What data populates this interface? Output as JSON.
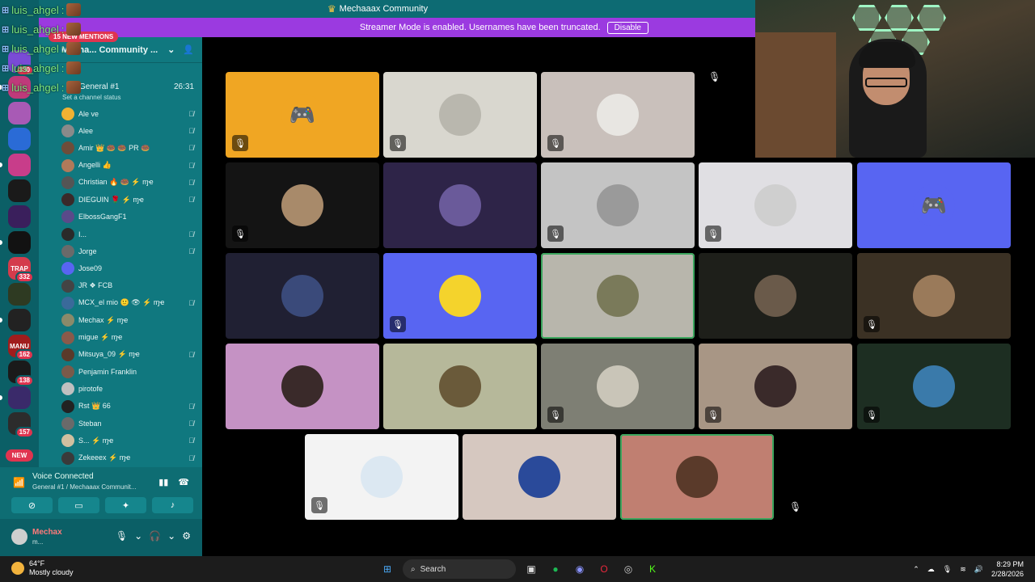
{
  "title_bar": {
    "server_title": "Mechaaax Community",
    "crown_icon": "crown-icon"
  },
  "streamer_banner": {
    "text": "Streamer Mode is enabled. Usernames have been truncated.",
    "button": "Disable"
  },
  "chat_overlay": [
    {
      "user": "luis_ahgel",
      "sep": ":"
    },
    {
      "user": "luis_ahgel",
      "sep": ":"
    },
    {
      "user": "luis_ahgel",
      "sep": ":"
    },
    {
      "user": "luis_ahgel",
      "sep": ":"
    },
    {
      "user": "luis_ahgel",
      "sep": ":"
    }
  ],
  "servers": [
    {
      "label": "",
      "badge": "330",
      "color": "#7a4bd6"
    },
    {
      "label": "",
      "badge": "",
      "color": "#bf3a7a"
    },
    {
      "label": "",
      "badge": "",
      "color": "#a85ab5"
    },
    {
      "label": "",
      "badge": "",
      "color": "#2a6bd6"
    },
    {
      "label": "",
      "badge": "",
      "color": "#c83d8a"
    },
    {
      "label": "",
      "badge": "",
      "color": "#1a1a1a"
    },
    {
      "label": "",
      "badge": "",
      "color": "#3a1f5c"
    },
    {
      "label": "",
      "badge": "",
      "color": "#121212"
    },
    {
      "label": "TRAP",
      "badge": "332",
      "color": "#d43c4c"
    },
    {
      "label": "",
      "badge": "",
      "color": "#2e3a22"
    },
    {
      "label": "",
      "badge": "",
      "color": "#222222"
    },
    {
      "label": "MANU",
      "badge": "162",
      "color": "#a01d1d"
    },
    {
      "label": "",
      "badge": "138",
      "color": "#1a1a1a"
    },
    {
      "label": "",
      "badge": "",
      "color": "#3a2a6a"
    },
    {
      "label": "",
      "badge": "157",
      "color": "#2c2c2c"
    }
  ],
  "new_pill": "NEW",
  "sidebar": {
    "server_name": "Mecha... Community ...",
    "mentions": "15 NEW MENTIONS",
    "channel_name": "General #1",
    "channel_time": "26:31",
    "channel_status": "Set a channel status",
    "members": [
      {
        "name": "Ale ve",
        "color": "#f0b232",
        "muted": true
      },
      {
        "name": "Alee",
        "color": "#8a8a8a",
        "muted": true
      },
      {
        "name": "Amir 👑 🍩 🍩 PR 🍩",
        "color": "#6e4d3a",
        "muted": true
      },
      {
        "name": "Angelli 👍",
        "color": "#b07a5a",
        "muted": true
      },
      {
        "name": "Christian 🔥 🍩 ⚡ ɱҽ",
        "color": "#555555",
        "muted": true
      },
      {
        "name": "DIEGUIN 🌹 ⚡ ɱҽ",
        "color": "#3a2a2a",
        "muted": true
      },
      {
        "name": "ElbossGangF1",
        "color": "#5a4a8a",
        "muted": false
      },
      {
        "name": "I...",
        "color": "#2a2a2a",
        "muted": true
      },
      {
        "name": "Jorge",
        "color": "#6a6a6a",
        "muted": true
      },
      {
        "name": "Jose09",
        "color": "#5865f2",
        "muted": false
      },
      {
        "name": "JR ❖ FCB",
        "color": "#444444",
        "muted": false
      },
      {
        "name": "MCX_el mio 🙂 👁 ⚡ ɱҽ",
        "color": "#3a6a9a",
        "muted": true
      },
      {
        "name": "Mechax ⚡ ɱҽ",
        "color": "#8a8a6a",
        "muted": false
      },
      {
        "name": "migue ⚡ ɱҽ",
        "color": "#8a5a4a",
        "muted": false
      },
      {
        "name": "Mitsuya_09 ⚡ ɱҽ",
        "color": "#5a3a2a",
        "muted": true
      },
      {
        "name": "Penjamin Franklin",
        "color": "#7a5a4a",
        "muted": false
      },
      {
        "name": "pirotofe",
        "color": "#c0c0c0",
        "muted": false
      },
      {
        "name": "Rst 👑 66",
        "color": "#222222",
        "muted": true
      },
      {
        "name": "Steban",
        "color": "#6a6a6a",
        "muted": true
      },
      {
        "name": "S... ⚡ ɱҽ",
        "color": "#d0c0a0",
        "muted": true
      },
      {
        "name": "Zekeeex ⚡ ɱҽ",
        "color": "#3a3a3a",
        "muted": true
      }
    ]
  },
  "voice": {
    "title": "Voice Connected",
    "subtitle": "General #1 / Mechaaax Communit..."
  },
  "user": {
    "name": "Mechax",
    "status": "m..."
  },
  "tiles": [
    {
      "bg": "#f0a623",
      "av": "#f0a623",
      "discord": true,
      "muted": true,
      "speaking": false
    },
    {
      "bg": "#d9d7cf",
      "av": "#b9b7ae",
      "discord": false,
      "muted": true,
      "speaking": false
    },
    {
      "bg": "#c9c0bb",
      "av": "#e8e6e2",
      "discord": false,
      "muted": true,
      "speaking": false
    },
    {
      "bg": "#141414",
      "av": "#a88a6a",
      "discord": false,
      "muted": true,
      "speaking": false
    },
    {
      "bg": "#2e2448",
      "av": "#6a5a9a",
      "discord": false,
      "muted": false,
      "speaking": false
    },
    {
      "bg": "#c4c4c4",
      "av": "#9a9a9a",
      "discord": false,
      "muted": true,
      "speaking": false
    },
    {
      "bg": "#e0dfe3",
      "av": "#cfcfcf",
      "discord": false,
      "muted": true,
      "speaking": false
    },
    {
      "bg": "#5865f2",
      "av": "#5865f2",
      "discord": true,
      "muted": false,
      "speaking": false
    },
    {
      "bg": "#202033",
      "av": "#3a4a7a",
      "discord": false,
      "muted": false,
      "speaking": false
    },
    {
      "bg": "#5865f2",
      "av": "#f4d32c",
      "discord": false,
      "muted": true,
      "speaking": false
    },
    {
      "bg": "#b8b6ac",
      "av": "#7a7a5a",
      "discord": false,
      "muted": false,
      "speaking": true
    },
    {
      "bg": "#1e1f1a",
      "av": "#6a5a4a",
      "discord": false,
      "muted": false,
      "speaking": false
    },
    {
      "bg": "#3b3124",
      "av": "#9a7a5a",
      "discord": false,
      "muted": true,
      "speaking": false
    },
    {
      "bg": "#c592c4",
      "av": "#3a2a2a",
      "discord": false,
      "muted": false,
      "speaking": false
    },
    {
      "bg": "#b6b89a",
      "av": "#6a5a3a",
      "discord": false,
      "muted": false,
      "speaking": false
    },
    {
      "bg": "#7e7f74",
      "av": "#c9c5b8",
      "discord": false,
      "muted": true,
      "speaking": false
    },
    {
      "bg": "#a89685",
      "av": "#3a2a2a",
      "discord": false,
      "muted": true,
      "speaking": false
    },
    {
      "bg": "#1d2e22",
      "av": "#3a7aaa",
      "discord": false,
      "muted": true,
      "speaking": false
    },
    {
      "bg": "#f3f3f3",
      "av": "#dce8f2",
      "discord": false,
      "muted": true,
      "speaking": false
    },
    {
      "bg": "#d6c8c0",
      "av": "#2a4a9a",
      "discord": false,
      "muted": false,
      "speaking": false
    },
    {
      "bg": "#c07f71",
      "av": "#5a3a2a",
      "discord": false,
      "muted": false,
      "speaking": true
    }
  ],
  "taskbar": {
    "temp": "64°F",
    "weather": "Mostly cloudy",
    "search": "Search",
    "time": "8:29 PM",
    "date": "2/28/2026"
  }
}
